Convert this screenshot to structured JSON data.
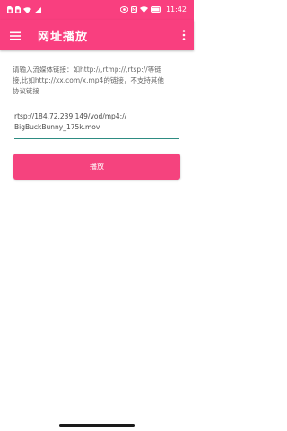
{
  "status_bar": {
    "time": "11:42",
    "battery_level": 1.0,
    "left_icons": [
      "sim-icon",
      "sim-icon",
      "wifi-icon",
      "signal-icon"
    ],
    "right_icons": [
      "eye-icon",
      "nfc-icon",
      "wifi-icon",
      "battery-icon"
    ]
  },
  "app_bar": {
    "title": "网址播放",
    "left_icon": "menu-icon",
    "right_icon": "more-vert-icon"
  },
  "prompt": {
    "lines": [
      "请输入流媒体链接：如http://,rtmp://,rtsp://等链",
      "接,比如http://xx.com/x.mp4的链接，不支持其他",
      "协议链接"
    ]
  },
  "url_input": {
    "lines": [
      "rtsp://184.72.239.149/vod/mp4://",
      "BigBuckBunny_175k.mov"
    ]
  },
  "play_button": {
    "label": "播放"
  },
  "colors": {
    "primary": "#f93f7f",
    "button": "#f5437e",
    "input_underline": "#2e8c82",
    "prompt_text": "#6a6a6a"
  }
}
